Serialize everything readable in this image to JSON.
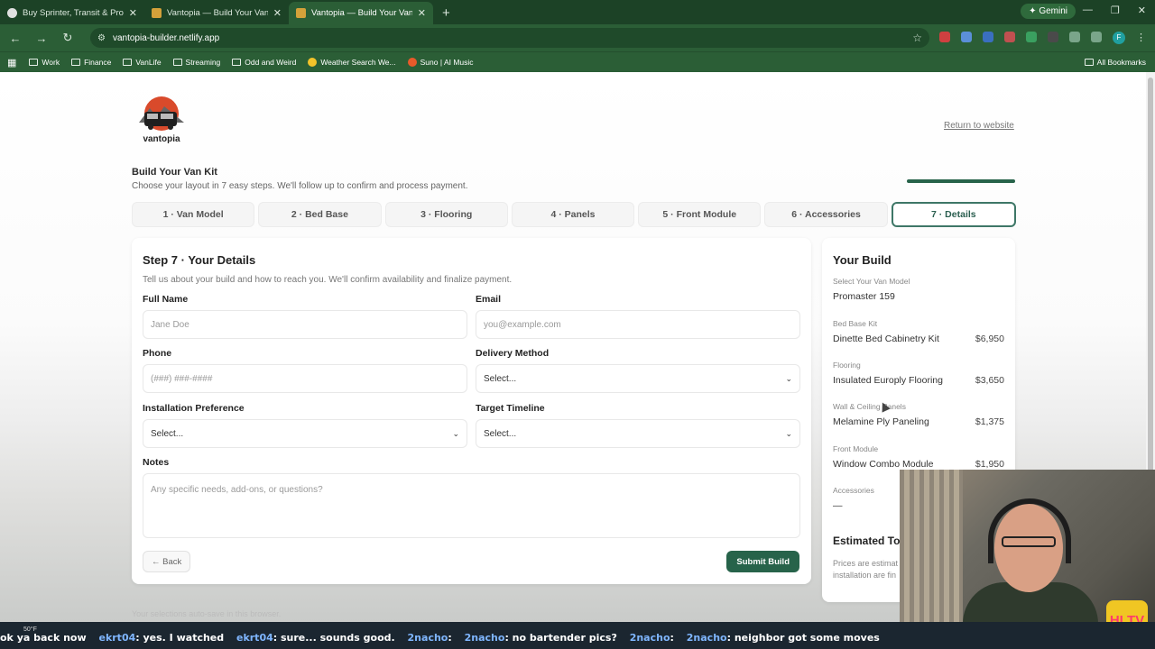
{
  "browser": {
    "tabs": [
      {
        "title": "Buy Sprinter, Transit & Promast",
        "active": false
      },
      {
        "title": "Vantopia — Build Your Van Kit",
        "active": false
      },
      {
        "title": "Vantopia — Build Your Van Kit",
        "active": true
      }
    ],
    "gemini_label": "Gemini",
    "url": "vantopia-builder.netlify.app",
    "bookmarks": [
      "Work",
      "Finance",
      "VanLife",
      "Streaming",
      "Odd and Weird",
      "Weather Search We...",
      "Suno | AI Music"
    ],
    "all_bookmarks": "All Bookmarks",
    "profile_initial": "F"
  },
  "page": {
    "logo_text": "vantopia",
    "return_link": "Return to website",
    "title": "Build Your Van Kit",
    "subtitle": "Choose your layout in 7 easy steps. We'll follow up to confirm and process payment.",
    "progress": 1.0,
    "steps": [
      "1 · Van Model",
      "2 · Bed Base",
      "3 · Flooring",
      "4 · Panels",
      "5 · Front Module",
      "6 · Accessories",
      "7 · Details"
    ],
    "active_step": 7,
    "footer_note": "Your selections auto-save in this browser."
  },
  "form": {
    "heading": "Step 7 · Your Details",
    "intro": "Tell us about your build and how to reach you. We'll confirm availability and finalize payment.",
    "full_name": {
      "label": "Full Name",
      "placeholder": "Jane Doe"
    },
    "email": {
      "label": "Email",
      "placeholder": "you@example.com"
    },
    "phone": {
      "label": "Phone",
      "placeholder": "(###) ###-####"
    },
    "delivery": {
      "label": "Delivery Method",
      "value": "Select..."
    },
    "install": {
      "label": "Installation Preference",
      "value": "Select..."
    },
    "timeline": {
      "label": "Target Timeline",
      "value": "Select..."
    },
    "notes": {
      "label": "Notes",
      "placeholder": "Any specific needs, add-ons, or questions?"
    },
    "back_label": "← Back",
    "submit_label": "Submit Build"
  },
  "summary": {
    "heading": "Your Build",
    "items": [
      {
        "label": "Select Your Van Model",
        "name": "Promaster 159",
        "price": ""
      },
      {
        "label": "Bed Base Kit",
        "name": "Dinette Bed Cabinetry Kit",
        "price": "$6,950"
      },
      {
        "label": "Flooring",
        "name": "Insulated Europly Flooring",
        "price": "$3,650"
      },
      {
        "label": "Wall & Ceiling Panels",
        "name": "Melamine Ply Paneling",
        "price": "$1,375"
      },
      {
        "label": "Front Module",
        "name": "Window Combo Module",
        "price": "$1,950"
      },
      {
        "label": "Accessories",
        "name": "—",
        "price": ""
      }
    ],
    "estimated_total": "Estimated To",
    "price_note_1": "Prices are estimat",
    "price_note_2": "installation are fin"
  },
  "taskbar": {
    "weather": "50°F",
    "ticker": [
      {
        "text": "ok ya back now",
        "user": ""
      },
      {
        "user": "ekrt04",
        "text": ": yes. I watched"
      },
      {
        "user": "ekrt04",
        "text": ": sure... sounds good."
      },
      {
        "user": "2nacho",
        "text": ":"
      },
      {
        "user": "2nacho",
        "text": ": no bartender pics?"
      },
      {
        "user": "2nacho",
        "text": ":"
      },
      {
        "user": "2nacho",
        "text": ": neighbor got some moves"
      }
    ]
  },
  "overlay": {
    "logo_text": "HI TV"
  },
  "colors": {
    "accent": "#27634a",
    "browser_chrome": "#2b5e36"
  }
}
